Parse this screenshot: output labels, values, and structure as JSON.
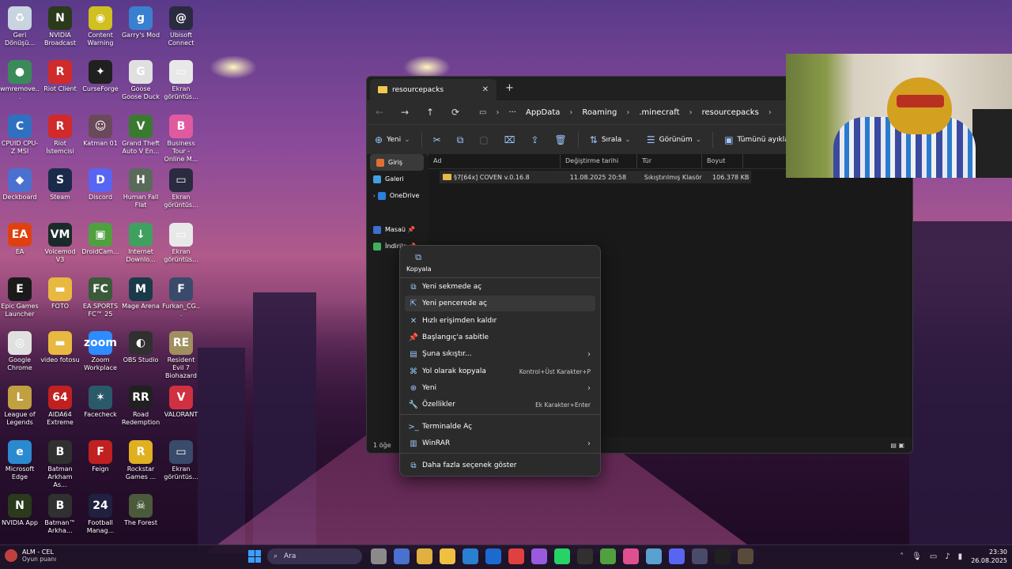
{
  "desktop": {
    "icons": [
      {
        "label": "Geri Dönüşü...",
        "color": "#c8d4e0",
        "glyph": "♻"
      },
      {
        "label": "NVIDIA Broadcast",
        "color": "#2a3a1a",
        "glyph": "N"
      },
      {
        "label": "Content Warning",
        "color": "#d0c020",
        "glyph": "◉"
      },
      {
        "label": "Garry's Mod",
        "color": "#3a80d0",
        "glyph": "g"
      },
      {
        "label": "Ubisoft Connect",
        "color": "#2a2a40",
        "glyph": "@"
      },
      {
        "label": "wmremove...",
        "color": "#3a8a5a",
        "glyph": "●"
      },
      {
        "label": "Riot Client",
        "color": "#d02a2a",
        "glyph": "R"
      },
      {
        "label": "CurseForge",
        "color": "#202020",
        "glyph": "✦"
      },
      {
        "label": "Goose Goose Duck",
        "color": "#e0e0e0",
        "glyph": "G"
      },
      {
        "label": "Ekran görüntüs...",
        "color": "#e8e8e8",
        "glyph": "▭"
      },
      {
        "label": "CPUID CPU-Z MSI",
        "color": "#3070c0",
        "glyph": "C"
      },
      {
        "label": "Riot İstemcisi",
        "color": "#d02a2a",
        "glyph": "R"
      },
      {
        "label": "Katman 01",
        "color": "#6a4a5a",
        "glyph": "☺"
      },
      {
        "label": "Grand Theft Auto V En...",
        "color": "#3a7a30",
        "glyph": "V"
      },
      {
        "label": "Business Tour - Online M...",
        "color": "#e05aa0",
        "glyph": "B"
      },
      {
        "label": "Deckboard",
        "color": "#4a70d0",
        "glyph": "◆"
      },
      {
        "label": "Steam",
        "color": "#1a2a4a",
        "glyph": "S"
      },
      {
        "label": "Discord",
        "color": "#5865f2",
        "glyph": "D"
      },
      {
        "label": "Human Fall Flat",
        "color": "#5a6a5a",
        "glyph": "H"
      },
      {
        "label": "Ekran görüntüs...",
        "color": "#2a2a40",
        "glyph": "▭"
      },
      {
        "label": "EA",
        "color": "#e04010",
        "glyph": "EA"
      },
      {
        "label": "Voicemod V3",
        "color": "#1a2a2a",
        "glyph": "VM"
      },
      {
        "label": "DroidCam...",
        "color": "#50a040",
        "glyph": "▣"
      },
      {
        "label": "Internet Downlo...",
        "color": "#40a060",
        "glyph": "↓"
      },
      {
        "label": "Ekran görüntüs...",
        "color": "#e8e8e8",
        "glyph": "▭"
      },
      {
        "label": "Epic Games Launcher",
        "color": "#1a1a1a",
        "glyph": "E"
      },
      {
        "label": "FOTO",
        "color": "#e8b840",
        "glyph": "▬"
      },
      {
        "label": "EA SPORTS FC™ 25",
        "color": "#3a5a3a",
        "glyph": "FC"
      },
      {
        "label": "Mage Arena",
        "color": "#1a3a4a",
        "glyph": "M"
      },
      {
        "label": "Furkan_CG...",
        "color": "#3a4a6a",
        "glyph": "F"
      },
      {
        "label": "Google Chrome",
        "color": "#e0e0e0",
        "glyph": "◎"
      },
      {
        "label": "video fotosu",
        "color": "#e8b840",
        "glyph": "▬"
      },
      {
        "label": "Zoom Workplace",
        "color": "#2d8cff",
        "glyph": "zoom"
      },
      {
        "label": "OBS Studio",
        "color": "#303030",
        "glyph": "◐"
      },
      {
        "label": "Resident Evil 7 Biohazard",
        "color": "#a09060",
        "glyph": "RE"
      },
      {
        "label": "League of Legends",
        "color": "#c0a040",
        "glyph": "L"
      },
      {
        "label": "AIDA64 Extreme",
        "color": "#c02020",
        "glyph": "64"
      },
      {
        "label": "Facecheck",
        "color": "#2a5a6a",
        "glyph": "✶"
      },
      {
        "label": "Road Redemption",
        "color": "#202020",
        "glyph": "RR"
      },
      {
        "label": "VALORANT",
        "color": "#d03040",
        "glyph": "V"
      },
      {
        "label": "Microsoft Edge",
        "color": "#2a8ad0",
        "glyph": "e"
      },
      {
        "label": "Batman Arkham As...",
        "color": "#303030",
        "glyph": "B"
      },
      {
        "label": "Feign",
        "color": "#c02020",
        "glyph": "F"
      },
      {
        "label": "Rockstar Games ...",
        "color": "#e0b020",
        "glyph": "R"
      },
      {
        "label": "Ekran görüntüs...",
        "color": "#3a4a6a",
        "glyph": "▭"
      },
      {
        "label": "NVIDIA App",
        "color": "#2a3a1a",
        "glyph": "N"
      },
      {
        "label": "Batman™ Arkha...",
        "color": "#303030",
        "glyph": "B"
      },
      {
        "label": "Football Manag...",
        "color": "#202040",
        "glyph": "24"
      },
      {
        "label": "The Forest",
        "color": "#4a5a3a",
        "glyph": "☠"
      }
    ]
  },
  "explorer": {
    "tab_title": "resourcepacks",
    "tab_close": "✕",
    "new_tab": "+",
    "nav": {
      "back": "←",
      "forward": "→",
      "up": "↑",
      "refresh": "⟳"
    },
    "breadcrumbs": [
      "AppData",
      "Roaming",
      ".minecraft",
      "resourcepacks"
    ],
    "toolbar": {
      "new_label": "Yeni",
      "sort_label": "Sırala",
      "view_label": "Görünüm",
      "select_all_label": "Tümünü ayıkla",
      "more": "•••"
    },
    "nav_pane": [
      {
        "label": "Giriş",
        "color": "#e07030",
        "selected": true
      },
      {
        "label": "Galeri",
        "color": "#40a0e0",
        "selected": false
      },
      {
        "label": "OneDrive",
        "color": "#2a80e0",
        "selected": false
      },
      {
        "label": "Masaü",
        "color": "#3a70d0",
        "selected": false
      },
      {
        "label": "İndirile",
        "color": "#40b060",
        "selected": false
      }
    ],
    "columns": [
      "Ad",
      "Değiştirme tarihi",
      "Tür",
      "Boyut"
    ],
    "files": [
      {
        "name": "§7[64x] COVEN v.0.16.8",
        "modified": "11.08.2025 20:58",
        "type": "Sıkıştırılmış Klasör",
        "size": "106.378 KB"
      }
    ],
    "status_text": "1 öğe"
  },
  "context_menu": {
    "copy_label": "Kopyala",
    "items": [
      {
        "label": "Yeni sekmede aç",
        "glyph": "⧉",
        "shortcut": "",
        "arrow": false
      },
      {
        "label": "Yeni pencerede aç",
        "glyph": "⇱",
        "shortcut": "",
        "arrow": false,
        "highlighted": true
      },
      {
        "label": "Hızlı erişimden kaldır",
        "glyph": "✕",
        "shortcut": "",
        "arrow": false
      },
      {
        "label": "Başlangıç'a sabitle",
        "glyph": "📌",
        "shortcut": "",
        "arrow": false
      },
      {
        "label": "Şuna sıkıştır...",
        "glyph": "▤",
        "shortcut": "",
        "arrow": true
      },
      {
        "label": "Yol olarak kopyala",
        "glyph": "⌘",
        "shortcut": "Kontrol+Üst Karakter+P",
        "arrow": false
      },
      {
        "label": "Yeni",
        "glyph": "⊕",
        "shortcut": "",
        "arrow": true
      },
      {
        "label": "Özellikler",
        "glyph": "🔧",
        "shortcut": "Ek Karakter+Enter",
        "arrow": false
      },
      {
        "label": "Terminalde Aç",
        "glyph": ">_",
        "shortcut": "",
        "arrow": false
      },
      {
        "label": "WinRAR",
        "glyph": "▥",
        "shortcut": "",
        "arrow": true
      },
      {
        "label": "Daha fazla seçenek göster",
        "glyph": "⧉",
        "shortcut": "",
        "arrow": false
      }
    ],
    "arrow_glyph": "›"
  },
  "taskbar": {
    "user_line1": "ALM - CEL",
    "user_line2": "Oyun puanı",
    "search_placeholder": "Ara",
    "time": "23:30",
    "date": "26.08.2025",
    "apps": [
      "#8a8a8a",
      "#4a70d0",
      "#e0b040",
      "#f0c040",
      "#2a80d0",
      "#1a6ad0",
      "#e04040",
      "#9a5ae0",
      "#25d366",
      "#303030",
      "#50a040",
      "#e05090",
      "#5aa0d0",
      "#5865f2",
      "#4a4a6a",
      "#202020",
      "#5a4a3a"
    ]
  }
}
